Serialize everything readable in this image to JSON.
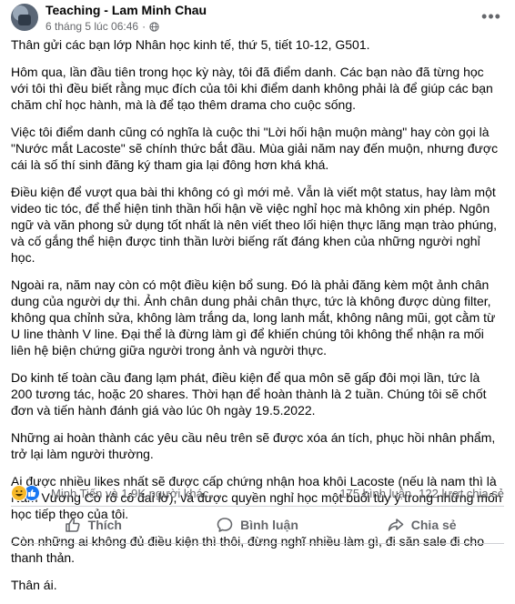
{
  "post": {
    "author": "Teaching - Lam Minh Chau",
    "timestamp": "6 tháng 5 lúc 06:46",
    "audience_icon": "globe-icon",
    "paragraphs": [
      "Thân gửi các bạn lớp Nhân học kinh tế, thứ 5, tiết 10-12, G501.",
      "Hôm qua, lần đầu tiên trong học kỳ này, tôi đã điểm danh. Các bạn nào đã từng học với tôi thì đều biết rằng mục đích của tôi khi điểm danh không phải là để giúp các bạn chăm chỉ học hành, mà là để tạo thêm drama cho cuộc sống.",
      "Việc tôi điểm danh cũng có nghĩa là cuộc thi \"Lời hối hận muộn màng\" hay còn gọi là \"Nước mắt Lacoste\" sẽ chính thức bắt đầu. Mùa giải năm nay đến muộn, nhưng được cái là số thí sinh đăng ký tham gia lại đông hơn khá khá.",
      "Điều kiện để vượt qua bài thi không có gì mới mẻ. Vẫn là viết một status, hay làm một video tic tóc, để thể hiện tinh thần hối hận về việc nghỉ học mà không xin phép. Ngôn ngữ và văn phong sử dụng tốt nhất là nên viết theo lối hiện thực lãng mạn trào phúng, và cố gắng thể hiện được tinh thần lười biếng rất đáng khen của những người nghỉ học.",
      "Ngoài ra, năm nay còn có một điều kiện bổ sung. Đó là phải đăng kèm một ảnh chân dung của người dự thi. Ảnh chân dung phải chân thực, tức là không được dùng filter, không qua chỉnh sửa, không làm trắng da, long lanh mắt, không nâng mũi, gọt cằm từ U line thành V line. Đại thể là đừng làm gì để khiến chúng tôi không thể nhận ra mối liên hệ biện chứng giữa người trong ảnh và người thực.",
      "Do kinh tế toàn cầu đang lạm phát, điều kiện để qua môn sẽ gấp đôi mọi lần, tức là 200 tương tác, hoặc 20 shares. Thời hạn để hoàn thành là 2 tuần. Chúng tôi sẽ chốt đơn và tiến hành đánh giá vào lúc 0h ngày 19.5.2022.",
      "Những ai hoàn thành các yêu cầu nêu trên sẽ được xóa án tích, phục hồi nhân phẩm, trở lại làm người thường.",
      "Ai được nhiều likes nhất sẽ được cấp chứng nhận hoa khôi Lacoste (nếu là nam thì là Nam Vương Cờ rô cô đai lờ), và được quyền nghỉ học một buổi tùy ý trong những môn học tiếp theo của tôi.",
      "Còn những ai không đủ điều kiện thì thôi, đừng nghĩ nhiều làm gì, đi săn sale đi cho thanh thản.",
      "Thân ái."
    ]
  },
  "reactions": {
    "icons": [
      "haha-icon",
      "like-icon"
    ],
    "summary": "Minh Tiến và 1,9K người khác",
    "comments": "175 bình luận",
    "shares": "122 lượt chia sẻ"
  },
  "actions": {
    "like": "Thích",
    "comment": "Bình luận",
    "share": "Chia sẻ"
  },
  "colors": {
    "text": "#050505",
    "secondary": "#65676b",
    "like_blue": "#1877f2",
    "haha_yellow": "#f7b928",
    "divider": "#ced0d4"
  }
}
